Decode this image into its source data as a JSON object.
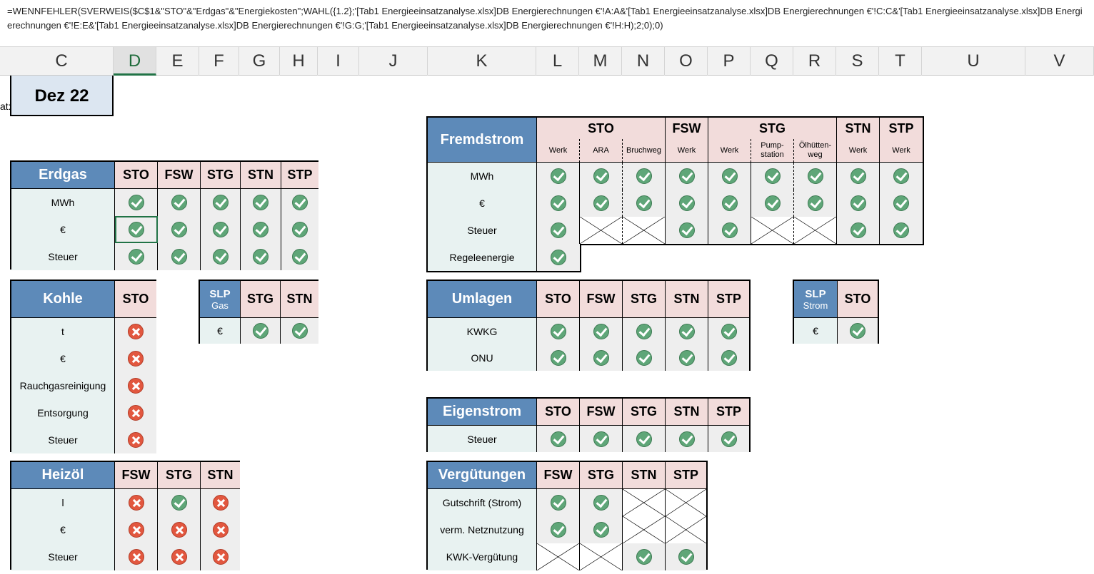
{
  "formula_bar": {
    "text": "=WENNFEHLER(SVERWEIS($C$1&\"STO\"&\"Erdgas\"&\"Energiekosten\";WAHL({1.2};'[Tab1 Energieeinsatzanalyse.xlsx]DB Energierechnungen €'!A:A&'[Tab1 Energieeinsatzanalyse.xlsx]DB Energierechnungen €'!C:C&'[Tab1 Energieeinsatzanalyse.xlsx]DB Energierechnungen €'!E:E&'[Tab1 Energieeinsatzanalyse.xlsx]DB Energierechnungen €'!G:G;'[Tab1 Energieeinsatzanalyse.xlsx]DB Energierechnungen €'!H:H);2;0);0)"
  },
  "column_headers": [
    "C",
    "D",
    "E",
    "F",
    "G",
    "H",
    "I",
    "J",
    "K",
    "L",
    "M",
    "N",
    "O",
    "P",
    "Q",
    "R",
    "S",
    "T",
    "U",
    "V"
  ],
  "selected_column": "D",
  "date_cell": "Dez 22",
  "cut_label": "at:",
  "colors": {
    "header_blue": "#5d8ab9",
    "header_pink": "#f2dcdb",
    "label_bg": "#e8f2f1",
    "value_bg": "#eeeeee",
    "ok": "#5fa678",
    "no": "#e2573f"
  },
  "tables": {
    "erdgas": {
      "title": "Erdgas",
      "cols": [
        "STO",
        "FSW",
        "STG",
        "STN",
        "STP"
      ],
      "rows": [
        {
          "label": "MWh",
          "v": [
            "ok",
            "ok",
            "ok",
            "ok",
            "ok"
          ]
        },
        {
          "label": "€",
          "v": [
            "ok",
            "ok",
            "ok",
            "ok",
            "ok"
          ]
        },
        {
          "label": "Steuer",
          "v": [
            "ok",
            "ok",
            "ok",
            "ok",
            "ok"
          ]
        }
      ]
    },
    "kohle": {
      "title": "Kohle",
      "cols": [
        "STO"
      ],
      "rows": [
        {
          "label": "t",
          "v": [
            "no"
          ]
        },
        {
          "label": "€",
          "v": [
            "no"
          ]
        },
        {
          "label": "Rauchgasreinigung",
          "v": [
            "no"
          ]
        },
        {
          "label": "Entsorgung",
          "v": [
            "no"
          ]
        },
        {
          "label": "Steuer",
          "v": [
            "no"
          ]
        }
      ]
    },
    "slp_gas": {
      "title": "SLP",
      "subtitle": "Gas",
      "cols": [
        "STG",
        "STN"
      ],
      "rows": [
        {
          "label": "€",
          "v": [
            "ok",
            "ok"
          ]
        }
      ]
    },
    "heizoel": {
      "title": "Heizöl",
      "cols": [
        "FSW",
        "STG",
        "STN"
      ],
      "rows": [
        {
          "label": "l",
          "v": [
            "no",
            "ok",
            "no"
          ]
        },
        {
          "label": "€",
          "v": [
            "no",
            "no",
            "no"
          ]
        },
        {
          "label": "Steuer",
          "v": [
            "no",
            "no",
            "no"
          ]
        }
      ]
    },
    "fremdstrom": {
      "title": "Fremdstrom",
      "groups": [
        {
          "name": "STO",
          "subs": [
            "Werk",
            "ARA",
            "Bruchweg"
          ]
        },
        {
          "name": "FSW",
          "subs": [
            "Werk"
          ]
        },
        {
          "name": "STG",
          "subs": [
            "Werk",
            "Pump-station",
            "Ölhütten-weg"
          ]
        },
        {
          "name": "STN",
          "subs": [
            "Werk"
          ]
        },
        {
          "name": "STP",
          "subs": [
            "Werk"
          ]
        }
      ],
      "rows": [
        {
          "label": "MWh",
          "v": [
            "ok",
            "ok",
            "ok",
            "ok",
            "ok",
            "ok",
            "ok",
            "ok",
            "ok"
          ]
        },
        {
          "label": "€",
          "v": [
            "ok",
            "ok",
            "ok",
            "ok",
            "ok",
            "ok",
            "ok",
            "ok",
            "ok"
          ]
        },
        {
          "label": "Steuer",
          "v": [
            "ok",
            "x",
            "x",
            "ok",
            "ok",
            "x",
            "x",
            "ok",
            "ok"
          ]
        },
        {
          "label": "Regeleenergie",
          "v": [
            "ok"
          ]
        }
      ]
    },
    "umlagen": {
      "title": "Umlagen",
      "cols": [
        "STO",
        "FSW",
        "STG",
        "STN",
        "STP"
      ],
      "rows": [
        {
          "label": "KWKG",
          "v": [
            "ok",
            "ok",
            "ok",
            "ok",
            "ok"
          ]
        },
        {
          "label": "ONU",
          "v": [
            "ok",
            "ok",
            "ok",
            "ok",
            "ok"
          ]
        }
      ]
    },
    "slp_strom": {
      "title": "SLP",
      "subtitle": "Strom",
      "cols": [
        "STO"
      ],
      "rows": [
        {
          "label": "€",
          "v": [
            "ok"
          ]
        }
      ]
    },
    "eigenstrom": {
      "title": "Eigenstrom",
      "cols": [
        "STO",
        "FSW",
        "STG",
        "STN",
        "STP"
      ],
      "rows": [
        {
          "label": "Steuer",
          "v": [
            "ok",
            "ok",
            "ok",
            "ok",
            "ok"
          ]
        }
      ]
    },
    "verguetungen": {
      "title": "Vergütungen",
      "cols": [
        "FSW",
        "STG",
        "STN",
        "STP"
      ],
      "rows": [
        {
          "label": "Gutschrift (Strom)",
          "v": [
            "ok",
            "ok",
            "x",
            "x"
          ]
        },
        {
          "label": "verm. Netznutzung",
          "v": [
            "ok",
            "ok",
            "x",
            "x"
          ]
        },
        {
          "label": "KWK-Vergütung",
          "v": [
            "x",
            "x",
            "ok",
            "ok"
          ]
        }
      ]
    }
  }
}
